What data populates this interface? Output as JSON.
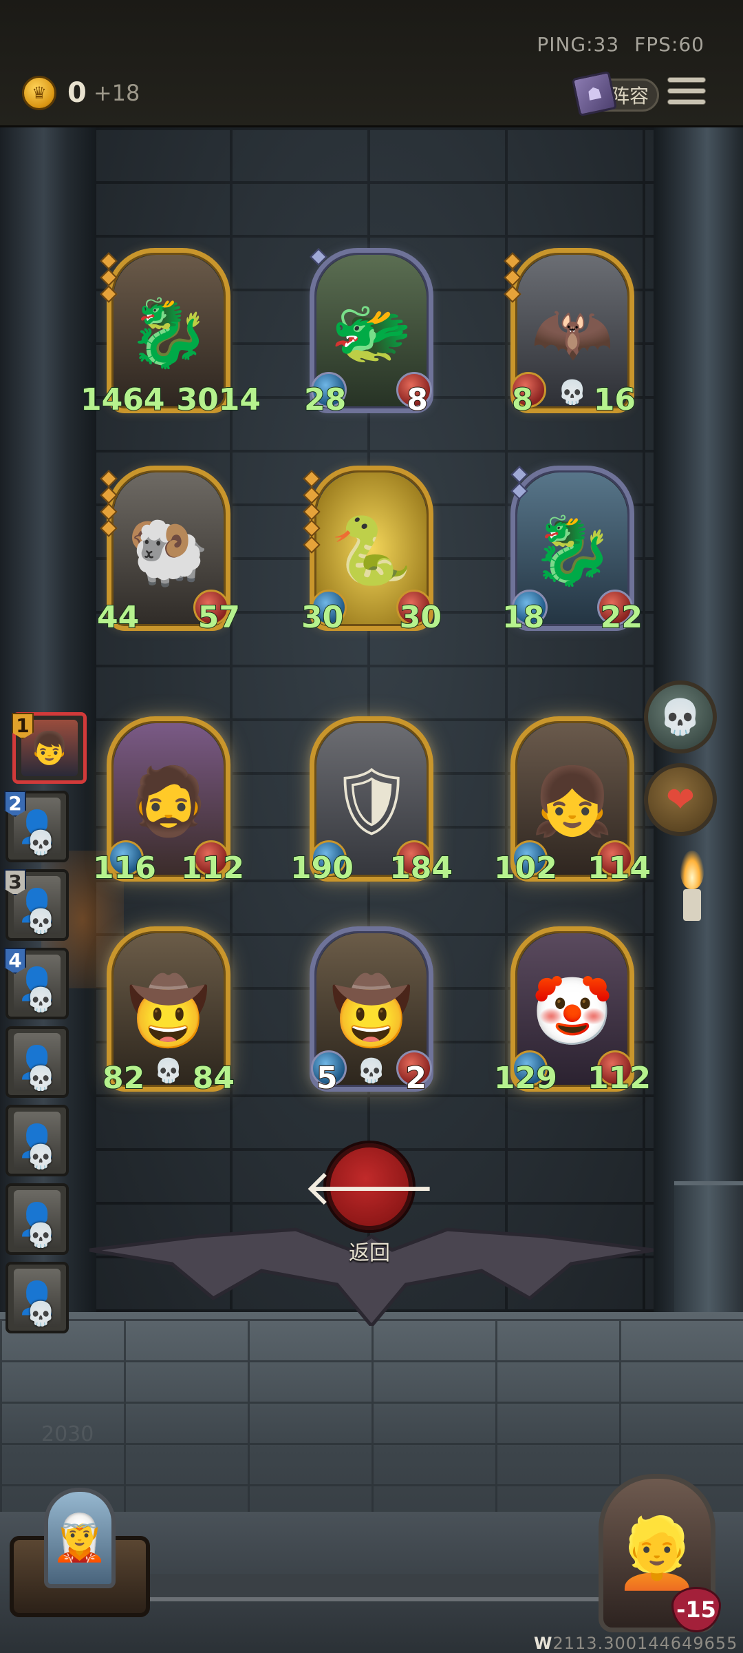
{
  "network": {
    "ping": "PING:33",
    "fps": "FPS:60"
  },
  "gold": {
    "amount": "0",
    "income": "+18",
    "icon": "crown-coin-icon"
  },
  "lineup_button": {
    "label": "阵容",
    "icon": "book-icon"
  },
  "menu_icon": "hamburger-menu-icon",
  "enemy_board": [
    {
      "name": "dark-dragon",
      "attack": "1464",
      "health": "3014",
      "frame": "gold",
      "tier_pips": 3,
      "glyph": "🐉"
    },
    {
      "name": "green-dragon",
      "attack": "28",
      "health": "8",
      "frame": "silver",
      "tier_pips": 1,
      "glyph": "🐲"
    },
    {
      "name": "bat-demon",
      "attack": "8",
      "health": "16",
      "frame": "gold",
      "tier_pips": 3,
      "glyph": "🦇",
      "deathrattle": true
    },
    {
      "name": "horned-beast",
      "attack": "44",
      "health": "57",
      "frame": "gold",
      "tier_pips": 4,
      "glyph": "🐏"
    },
    {
      "name": "golden-dragon",
      "attack": "30",
      "health": "30",
      "frame": "gold",
      "tier_pips": 5,
      "glyph": "🐍"
    },
    {
      "name": "azure-dragon",
      "attack": "18",
      "health": "22",
      "frame": "silver",
      "tier_pips": 2,
      "glyph": "🐉"
    }
  ],
  "player_board": [
    {
      "name": "red-haired-brute",
      "attack": "116",
      "health": "112",
      "frame": "gold",
      "glyph": "🧔"
    },
    {
      "name": "armored-knight",
      "attack": "190",
      "health": "184",
      "frame": "gold",
      "glyph": "🛡"
    },
    {
      "name": "bandana-girl",
      "attack": "102",
      "health": "114",
      "frame": "gold",
      "glyph": "👧"
    },
    {
      "name": "gunslinger",
      "attack": "82",
      "health": "84",
      "frame": "gold",
      "glyph": "🤠",
      "deathrattle": true
    },
    {
      "name": "gunslinger-copy",
      "attack": "5",
      "health": "2",
      "frame": "silver",
      "glyph": "🤠",
      "deathrattle": true
    },
    {
      "name": "jester-clown",
      "attack": "129",
      "health": "112",
      "frame": "gold",
      "glyph": "🤡"
    }
  ],
  "queue": [
    {
      "rank": "1",
      "glyph": "👦",
      "active": true
    },
    {
      "rank": "2",
      "glyph": "👤",
      "dead": true
    },
    {
      "rank": "3",
      "glyph": "👤",
      "dead": true
    },
    {
      "rank": "4",
      "glyph": "👤",
      "dead": true
    },
    {
      "rank": "",
      "glyph": "👤",
      "dead": true
    },
    {
      "rank": "",
      "glyph": "👤",
      "dead": true
    },
    {
      "rank": "",
      "glyph": "👤",
      "dead": true
    },
    {
      "rank": "",
      "glyph": "👤",
      "dead": true
    }
  ],
  "side_buttons": [
    {
      "name": "ghost-skull-button",
      "glyph": "💀"
    },
    {
      "name": "heart-emblem-button",
      "glyph": "❤"
    }
  ],
  "back": {
    "label": "返回",
    "glyph": "🡐"
  },
  "hero": {
    "health": "-15",
    "glyph": "👱"
  },
  "shop": {
    "glyph": "🧝"
  },
  "build_info": {
    "prefix": "W",
    "code": "2113.300144649655"
  },
  "faded_emblem": "2030"
}
